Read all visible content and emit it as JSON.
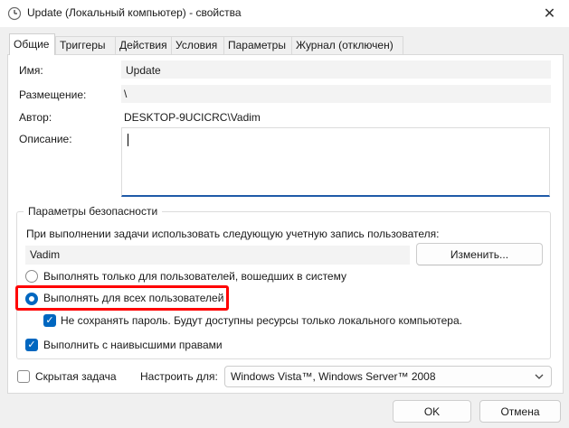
{
  "window": {
    "title": "Update (Локальный компьютер) - свойства",
    "icon": "clock-icon",
    "close_glyph": "✕"
  },
  "tabs": [
    {
      "label": "Общие",
      "active": true
    },
    {
      "label": "Триггеры",
      "active": false
    },
    {
      "label": "Действия",
      "active": false
    },
    {
      "label": "Условия",
      "active": false
    },
    {
      "label": "Параметры",
      "active": false
    },
    {
      "label": "Журнал (отключен)",
      "active": false
    }
  ],
  "general": {
    "name_label": "Имя:",
    "name_value": "Update",
    "location_label": "Размещение:",
    "location_value": "\\",
    "author_label": "Автор:",
    "author_value": "DESKTOP-9UCICRC\\Vadim",
    "description_label": "Описание:",
    "description_value": ""
  },
  "security": {
    "legend": "Параметры безопасности",
    "account_prompt": "При выполнении задачи использовать следующую учетную запись пользователя:",
    "account_value": "Vadim",
    "change_button": "Изменить...",
    "radio_logged_on": "Выполнять только для пользователей, вошедших в систему",
    "radio_all_users": "Выполнять для всех пользователей",
    "selected_radio": "all_users",
    "no_store_password": "Не сохранять пароль. Будут доступны ресурсы только локального компьютера.",
    "no_store_password_checked": true,
    "highest_privileges": "Выполнить с наивысшими правами",
    "highest_privileges_checked": true
  },
  "bottom": {
    "hidden_label": "Скрытая задача",
    "hidden_checked": false,
    "configure_label": "Настроить для:",
    "configure_value": "Windows Vista™, Windows Server™ 2008",
    "ok": "OK",
    "cancel": "Отмена"
  },
  "colors": {
    "accent": "#0067c0",
    "highlight": "#ff0000"
  }
}
